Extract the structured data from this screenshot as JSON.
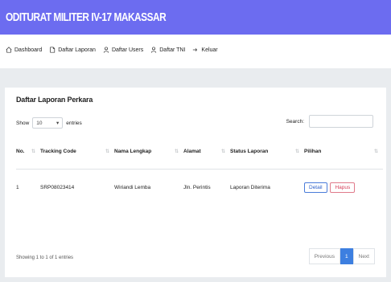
{
  "header": {
    "title": "ODITURAT MILITER IV-17 MAKASSAR"
  },
  "nav": [
    {
      "label": "Dashboard",
      "icon": "home-icon"
    },
    {
      "label": "Daftar Laporan",
      "icon": "document-icon"
    },
    {
      "label": "Daftar Users",
      "icon": "users-icon"
    },
    {
      "label": "Daftar TNI",
      "icon": "users-icon"
    },
    {
      "label": "Keluar",
      "icon": "logout-icon"
    }
  ],
  "card": {
    "title": "Daftar Laporan Perkara",
    "length_prefix": "Show",
    "length_value": "10",
    "length_suffix": "entries",
    "search_label": "Search:",
    "search_value": ""
  },
  "table": {
    "columns": [
      "No.",
      "Tracking Code",
      "Nama Lengkap",
      "Alamat",
      "Status Laporan",
      "Pilihan"
    ],
    "rows": [
      {
        "no": "1",
        "tracking": "SRP08023414",
        "nama": "Wiriandi Lemba",
        "alamat": "Jln. Perintis",
        "status": "Laporan Diterima",
        "detail": "Detail",
        "hapus": "Hapus"
      }
    ]
  },
  "footer": {
    "info": "Showing 1 to 1 of 1 entries",
    "prev": "Previous",
    "page": "1",
    "next": "Next"
  },
  "colors": {
    "header": "#6c6cf0",
    "accent": "#3d7fe0",
    "danger": "#d6405a"
  }
}
